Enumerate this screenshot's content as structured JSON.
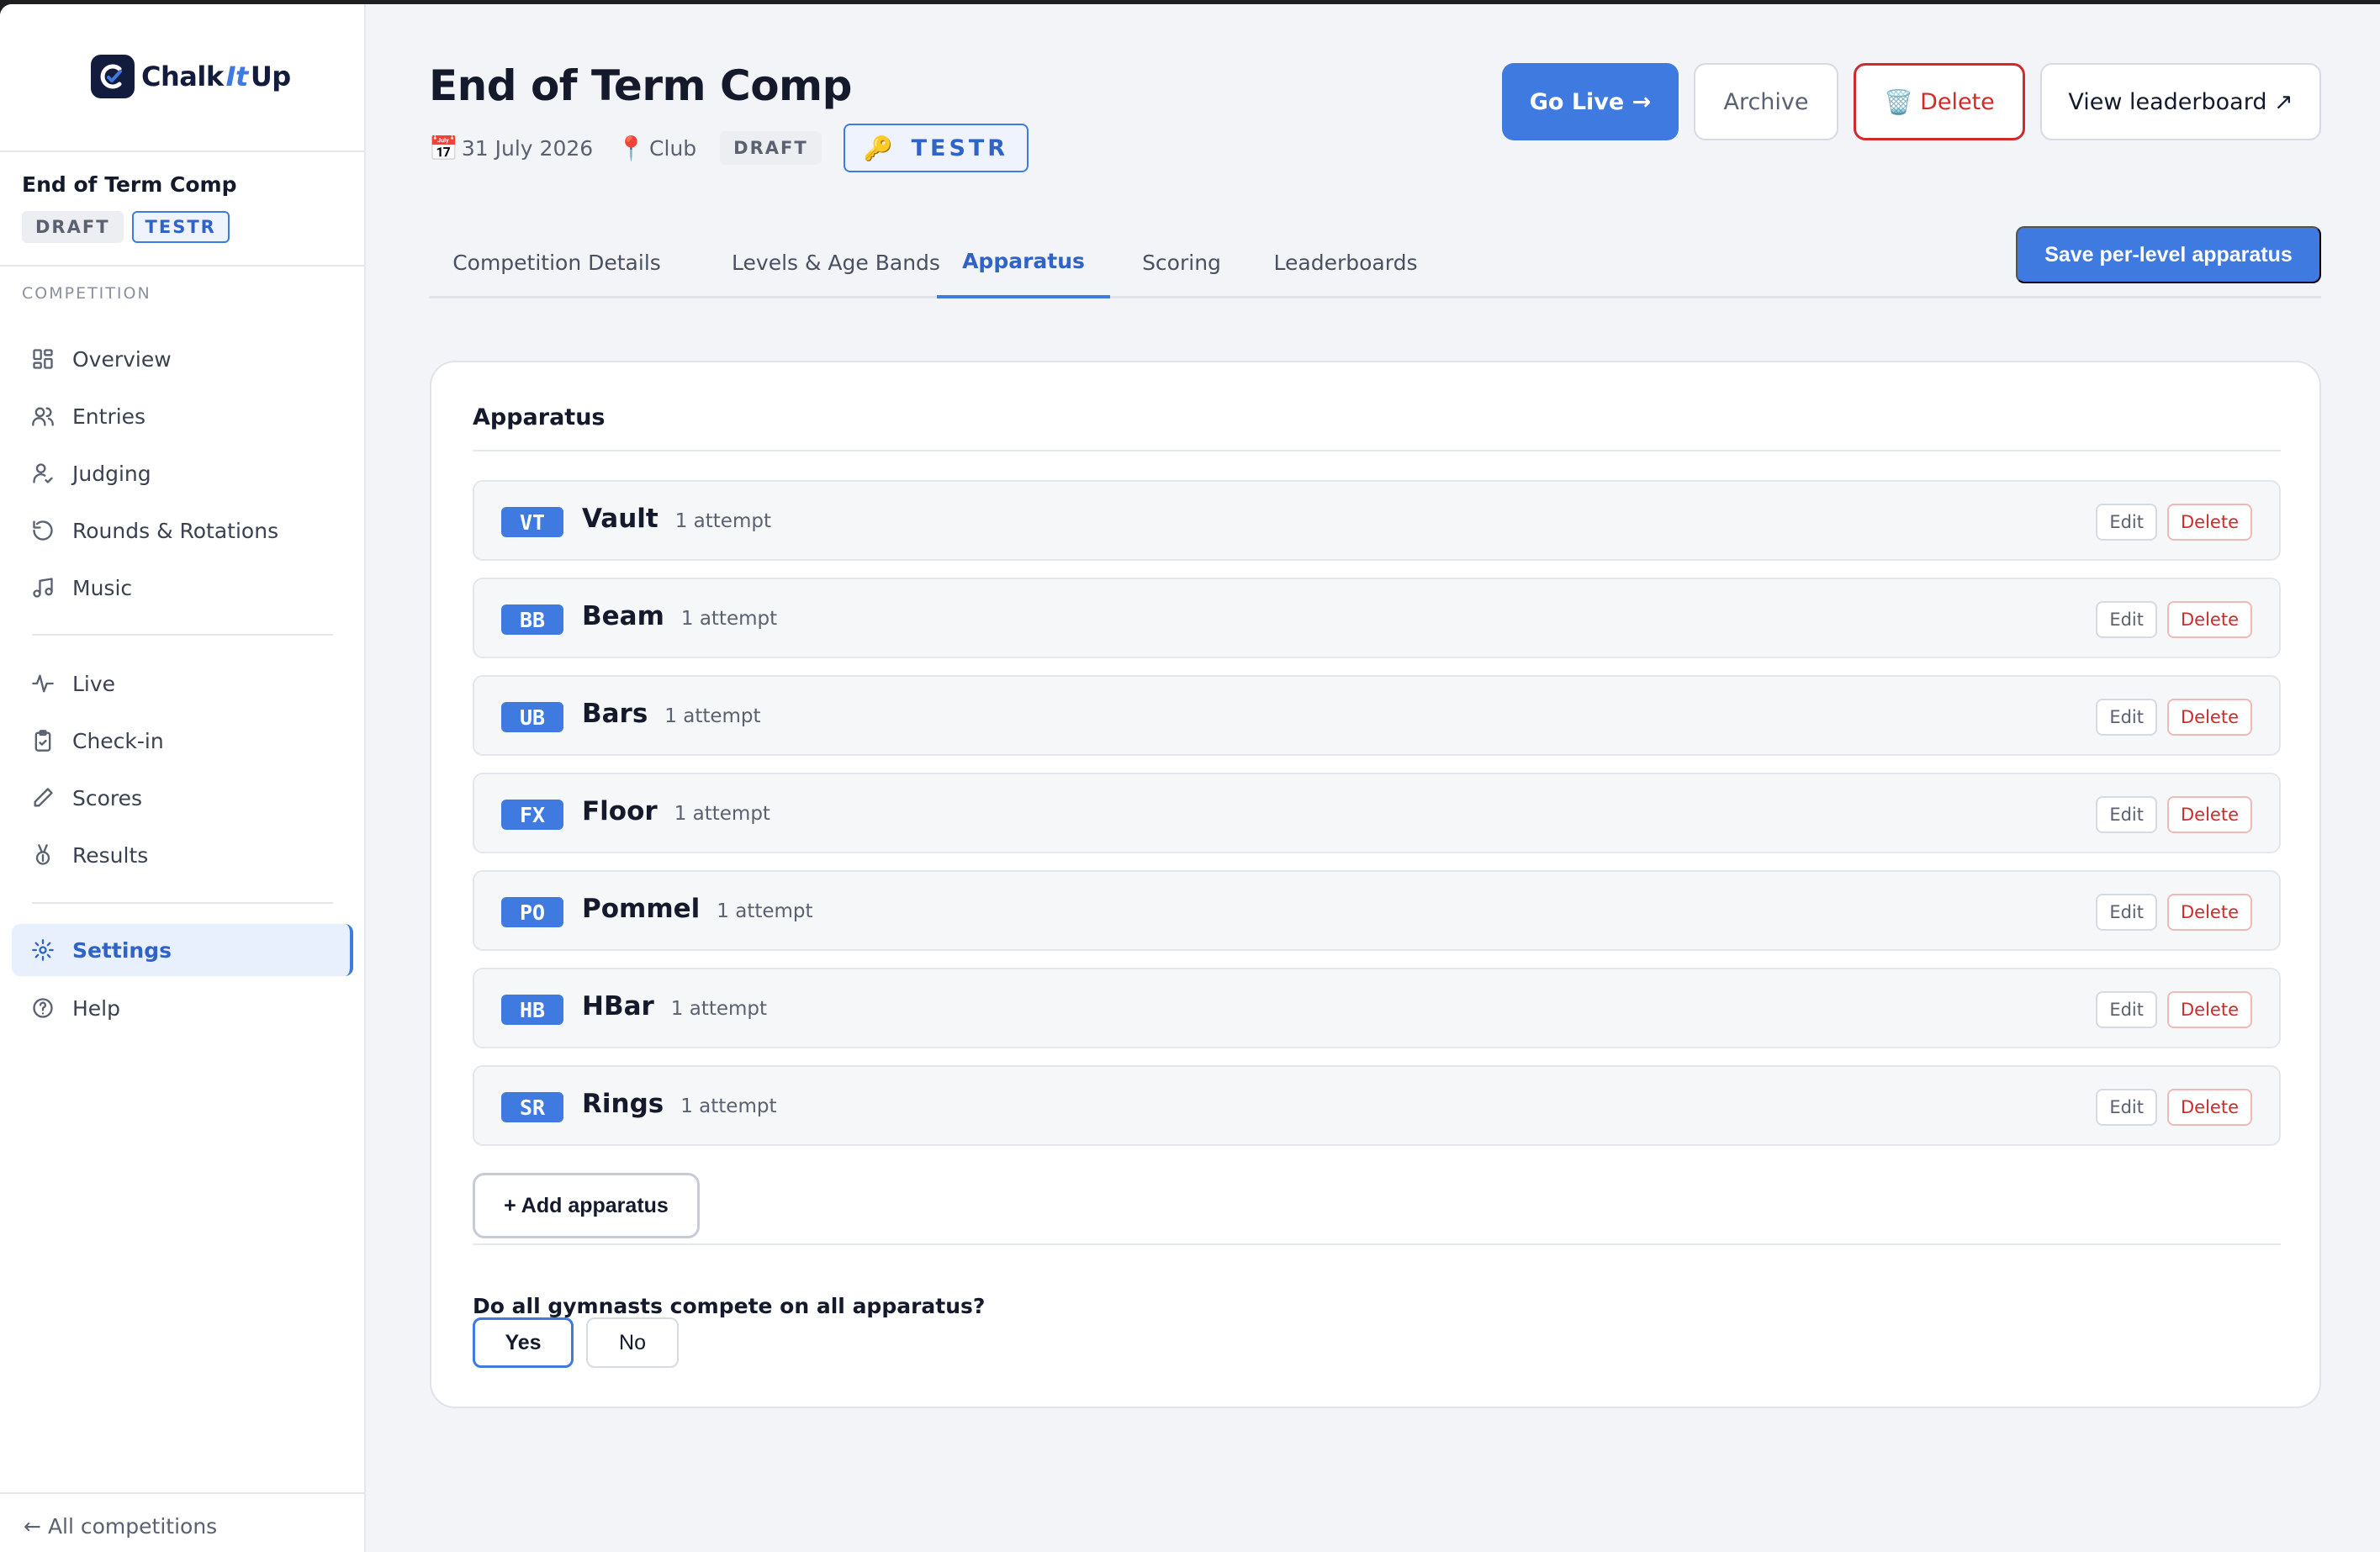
{
  "brand": {
    "name_left": "Chalk",
    "name_mid": "It",
    "name_right": "Up"
  },
  "sidebar": {
    "comp_title": "End of Term Comp",
    "status_badge": "DRAFT",
    "code_badge": "TESTR",
    "section_label": "COMPETITION",
    "nav_group1": [
      {
        "label": "Overview",
        "icon": "grid-icon"
      },
      {
        "label": "Entries",
        "icon": "users-icon"
      },
      {
        "label": "Judging",
        "icon": "judge-icon"
      },
      {
        "label": "Rounds & Rotations",
        "icon": "rotate-icon"
      },
      {
        "label": "Music",
        "icon": "music-icon"
      }
    ],
    "nav_group2": [
      {
        "label": "Live",
        "icon": "pulse-icon"
      },
      {
        "label": "Check-in",
        "icon": "clipboard-check-icon"
      },
      {
        "label": "Scores",
        "icon": "pencil-icon"
      },
      {
        "label": "Results",
        "icon": "medal-icon"
      }
    ],
    "nav_group3": [
      {
        "label": "Settings",
        "icon": "gear-icon",
        "active": true
      },
      {
        "label": "Help",
        "icon": "help-circle-icon"
      }
    ],
    "back_arrow": "←",
    "back_link": "All competitions"
  },
  "header": {
    "title": "End of Term Comp",
    "date_icon": "📅",
    "date": "31 July 2026",
    "location_icon": "📍",
    "location": "Club",
    "status": "DRAFT",
    "code_icon": "🔑",
    "code": "TESTR",
    "actions": {
      "go_live": "Go Live →",
      "archive": "Archive",
      "delete_icon": "🗑️",
      "delete": "Delete",
      "view_leaderboard": "View leaderboard ↗"
    }
  },
  "tabs": [
    {
      "label": "Competition Details"
    },
    {
      "label": "Levels & Age Bands"
    },
    {
      "label": "Apparatus",
      "active": true
    },
    {
      "label": "Scoring"
    },
    {
      "label": "Leaderboards"
    }
  ],
  "save_button": "Save per-level apparatus",
  "apparatus": {
    "heading": "Apparatus",
    "items": [
      {
        "code": "VT",
        "name": "Vault",
        "attempts": "1 attempt"
      },
      {
        "code": "BB",
        "name": "Beam",
        "attempts": "1 attempt"
      },
      {
        "code": "UB",
        "name": "Bars",
        "attempts": "1 attempt"
      },
      {
        "code": "FX",
        "name": "Floor",
        "attempts": "1 attempt"
      },
      {
        "code": "PO",
        "name": "Pommel",
        "attempts": "1 attempt"
      },
      {
        "code": "HB",
        "name": "HBar",
        "attempts": "1 attempt"
      },
      {
        "code": "SR",
        "name": "Rings",
        "attempts": "1 attempt"
      }
    ],
    "edit_label": "Edit",
    "delete_label": "Delete",
    "add_button": "+ Add apparatus",
    "question": "Do all gymnasts compete on all apparatus?",
    "yes_label": "Yes",
    "no_label": "No",
    "selected": "Yes"
  },
  "colors": {
    "accent": "#3f7ae0",
    "danger": "#d12a2a",
    "brand_dark": "#141c3d"
  }
}
